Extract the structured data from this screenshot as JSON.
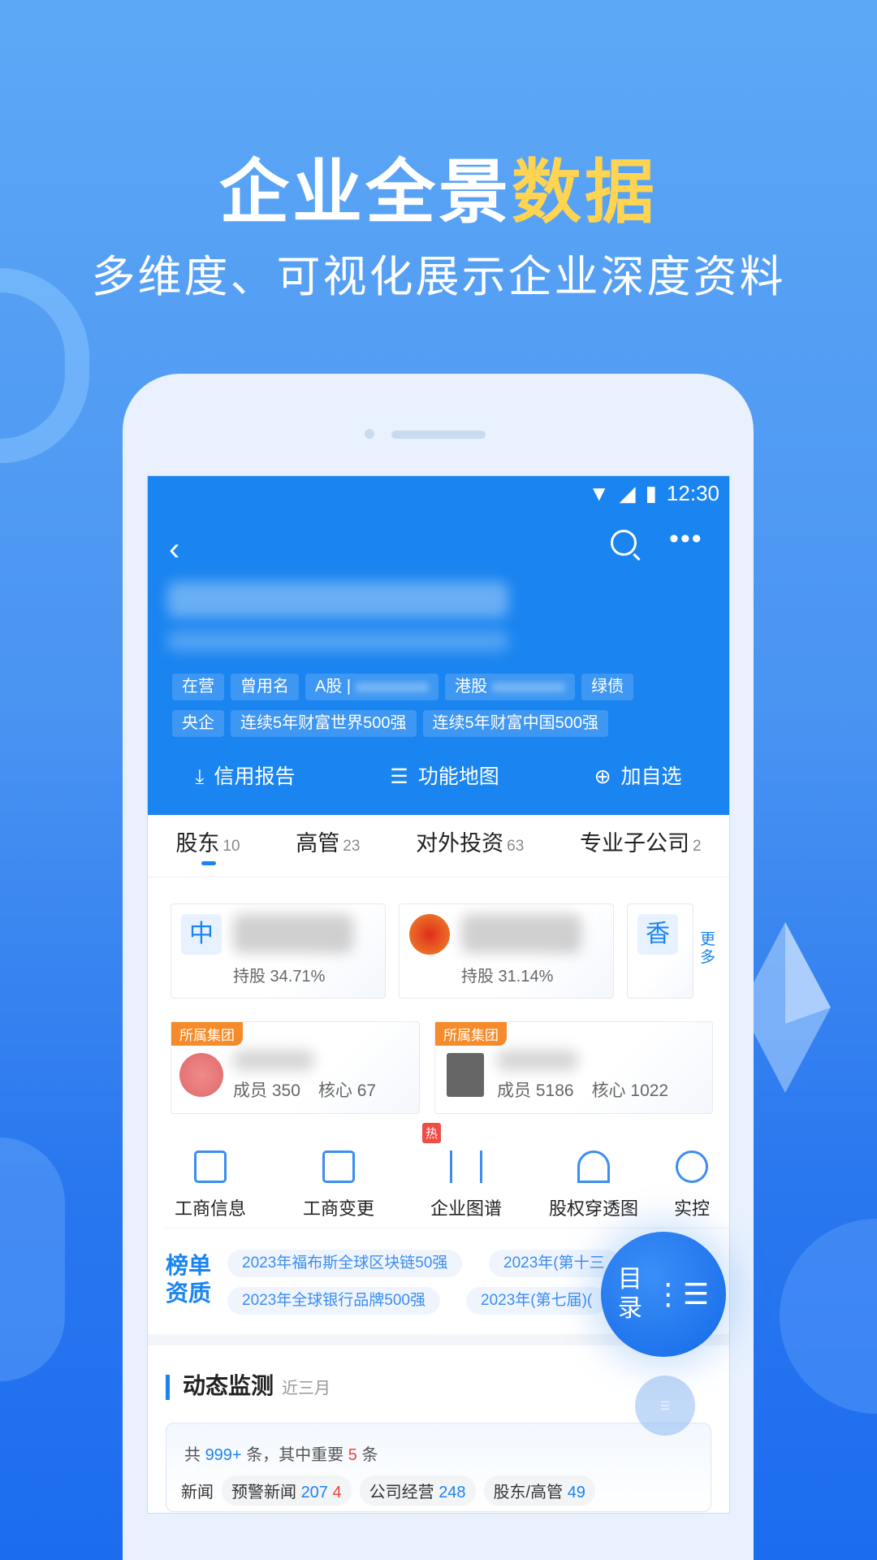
{
  "hero": {
    "title_main": "企业全景",
    "title_highlight": "数据",
    "subtitle": "多维度、可视化展示企业深度资料"
  },
  "status_bar": {
    "time": "12:30"
  },
  "header": {
    "tags_row1": [
      "在营",
      "曾用名",
      "A股 |",
      "港股",
      "绿债"
    ],
    "tags_row2": [
      "央企",
      "连续5年财富世界500强",
      "连续5年财富中国500强"
    ],
    "actions": [
      {
        "icon": "download-icon",
        "label": "信用报告"
      },
      {
        "icon": "list-icon",
        "label": "功能地图"
      },
      {
        "icon": "plus-circle-icon",
        "label": "加自选"
      }
    ]
  },
  "tabs": [
    {
      "label": "股东",
      "count": "10"
    },
    {
      "label": "高管",
      "count": "23"
    },
    {
      "label": "对外投资",
      "count": "63"
    },
    {
      "label": "专业子公司",
      "count": "2"
    }
  ],
  "shareholders": [
    {
      "logo": "中",
      "share": "持股 34.71%"
    },
    {
      "logo": "",
      "share": "持股 31.14%"
    },
    {
      "logo": "香",
      "share": ""
    }
  ],
  "more_label": "更多",
  "groups": [
    {
      "badge": "所属集团",
      "members": "成员 350",
      "core": "核心 67"
    },
    {
      "badge": "所属集团",
      "members": "成员 5186",
      "core": "核心 1022"
    }
  ],
  "functions": [
    {
      "label": "工商信息",
      "icon": "business-info-icon"
    },
    {
      "label": "工商变更",
      "icon": "business-change-icon"
    },
    {
      "label": "企业图谱",
      "icon": "graph-icon",
      "hot": "热"
    },
    {
      "label": "股权穿透图",
      "icon": "equity-tree-icon"
    },
    {
      "label": "实控",
      "icon": "controller-icon"
    }
  ],
  "rankings": {
    "title": "榜单资质",
    "chips": [
      "2023年福布斯全球区块链50强",
      "2023年(第十三",
      "2023年全球银行品牌500强",
      "2023年(第七届)("
    ]
  },
  "monitor": {
    "title": "动态监测",
    "period": "近三月",
    "sum_prefix": "共",
    "total": "999+",
    "sum_mid": "条，其中重要",
    "important": "5",
    "sum_suffix": "条",
    "row_label": "新闻",
    "items": [
      {
        "label": "预警新闻",
        "count": "207",
        "alert": "4"
      },
      {
        "label": "公司经营",
        "count": "248"
      },
      {
        "label": "股东/高管",
        "count": "49"
      }
    ]
  },
  "fab": {
    "label": "目录"
  },
  "colors": {
    "brand": "#1a84f0",
    "highlight": "#ffd452",
    "badge": "#f58b2a",
    "alert": "#f04437"
  }
}
